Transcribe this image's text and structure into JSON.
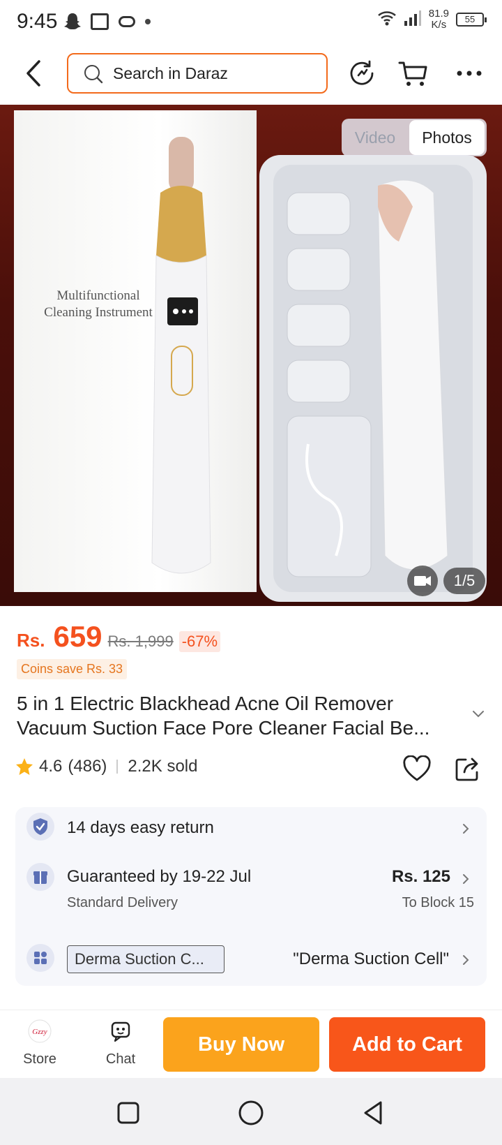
{
  "status_bar": {
    "time": "9:45",
    "net_speed_value": "81.9",
    "net_speed_unit": "K/s",
    "battery": "55",
    "icons": [
      "snapchat-icon",
      "notification-box-icon",
      "game-icon",
      "dot-icon",
      "wifi-icon",
      "signal-icon"
    ]
  },
  "header": {
    "search_placeholder": "Search in Daraz",
    "icons": [
      "back-icon",
      "search-icon",
      "history-icon",
      "cart-icon",
      "more-icon"
    ]
  },
  "gallery": {
    "box_text_line1": "Multifunctional",
    "box_text_line2": "Cleaning Instrument",
    "toggle_video": "Video",
    "toggle_photos": "Photos",
    "selected_tab": "Photos",
    "page_counter": "1/5"
  },
  "product": {
    "currency": "Rs.",
    "price": "659",
    "original_price": "Rs. 1,999",
    "discount": "-67%",
    "coins": "Coins save Rs. 33",
    "title": "5 in 1 Electric Blackhead Acne Oil Remover Vacuum Suction Face Pore Cleaner Facial Be...",
    "rating": "4.6",
    "reviews": "(486)",
    "sold": "2.2K sold"
  },
  "info": {
    "return_text": "14 days easy return",
    "delivery_text": "Guaranteed by 19-22 Jul",
    "delivery_sub": "Standard Delivery",
    "shipping_price": "Rs. 125",
    "shipping_dest": "To Block 15",
    "store_tag": "Derma Suction C...",
    "store_name": "\"Derma Suction Cell\""
  },
  "action_bar": {
    "store_label": "Store",
    "chat_label": "Chat",
    "buy_now": "Buy Now",
    "add_to_cart": "Add to Cart"
  },
  "colors": {
    "accent_orange": "#f4511e",
    "buy_now": "#fba31c",
    "add_to_cart": "#f8561a",
    "search_border": "#f36a1b"
  }
}
